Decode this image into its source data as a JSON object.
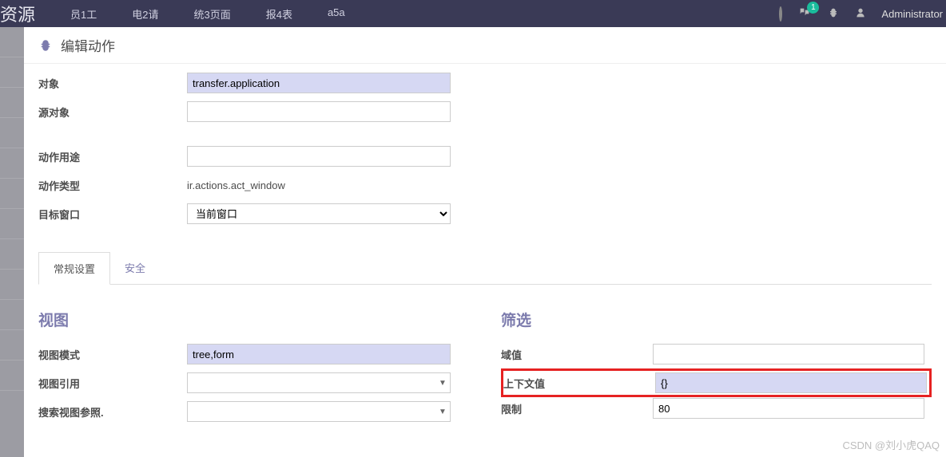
{
  "topbar": {
    "brand": "资源",
    "crumbs": [
      "员1工",
      "电2请",
      "统3页面",
      "报4表",
      "a5a"
    ],
    "badge": "1",
    "admin": "Administrator"
  },
  "page": {
    "title": "编辑动作"
  },
  "form": {
    "object_label": "对象",
    "object_value": "transfer.application",
    "src_object_label": "源对象",
    "src_object_value": "",
    "usage_label": "动作用途",
    "usage_value": "",
    "type_label": "动作类型",
    "type_value": "ir.actions.act_window",
    "target_label": "目标窗口",
    "target_value": "当前窗口"
  },
  "tabs": {
    "general": "常规设置",
    "security": "安全"
  },
  "view": {
    "title": "视图",
    "mode_label": "视图模式",
    "mode_value": "tree,form",
    "ref_label": "视图引用",
    "ref_value": "",
    "search_ref_label": "搜索视图参照.",
    "search_ref_value": ""
  },
  "filter": {
    "title": "筛选",
    "domain_label": "域值",
    "domain_value": "",
    "context_label": "上下文值",
    "context_value": "{}",
    "limit_label": "限制",
    "limit_value": "80"
  },
  "watermark": "CSDN @刘小虎QAQ"
}
